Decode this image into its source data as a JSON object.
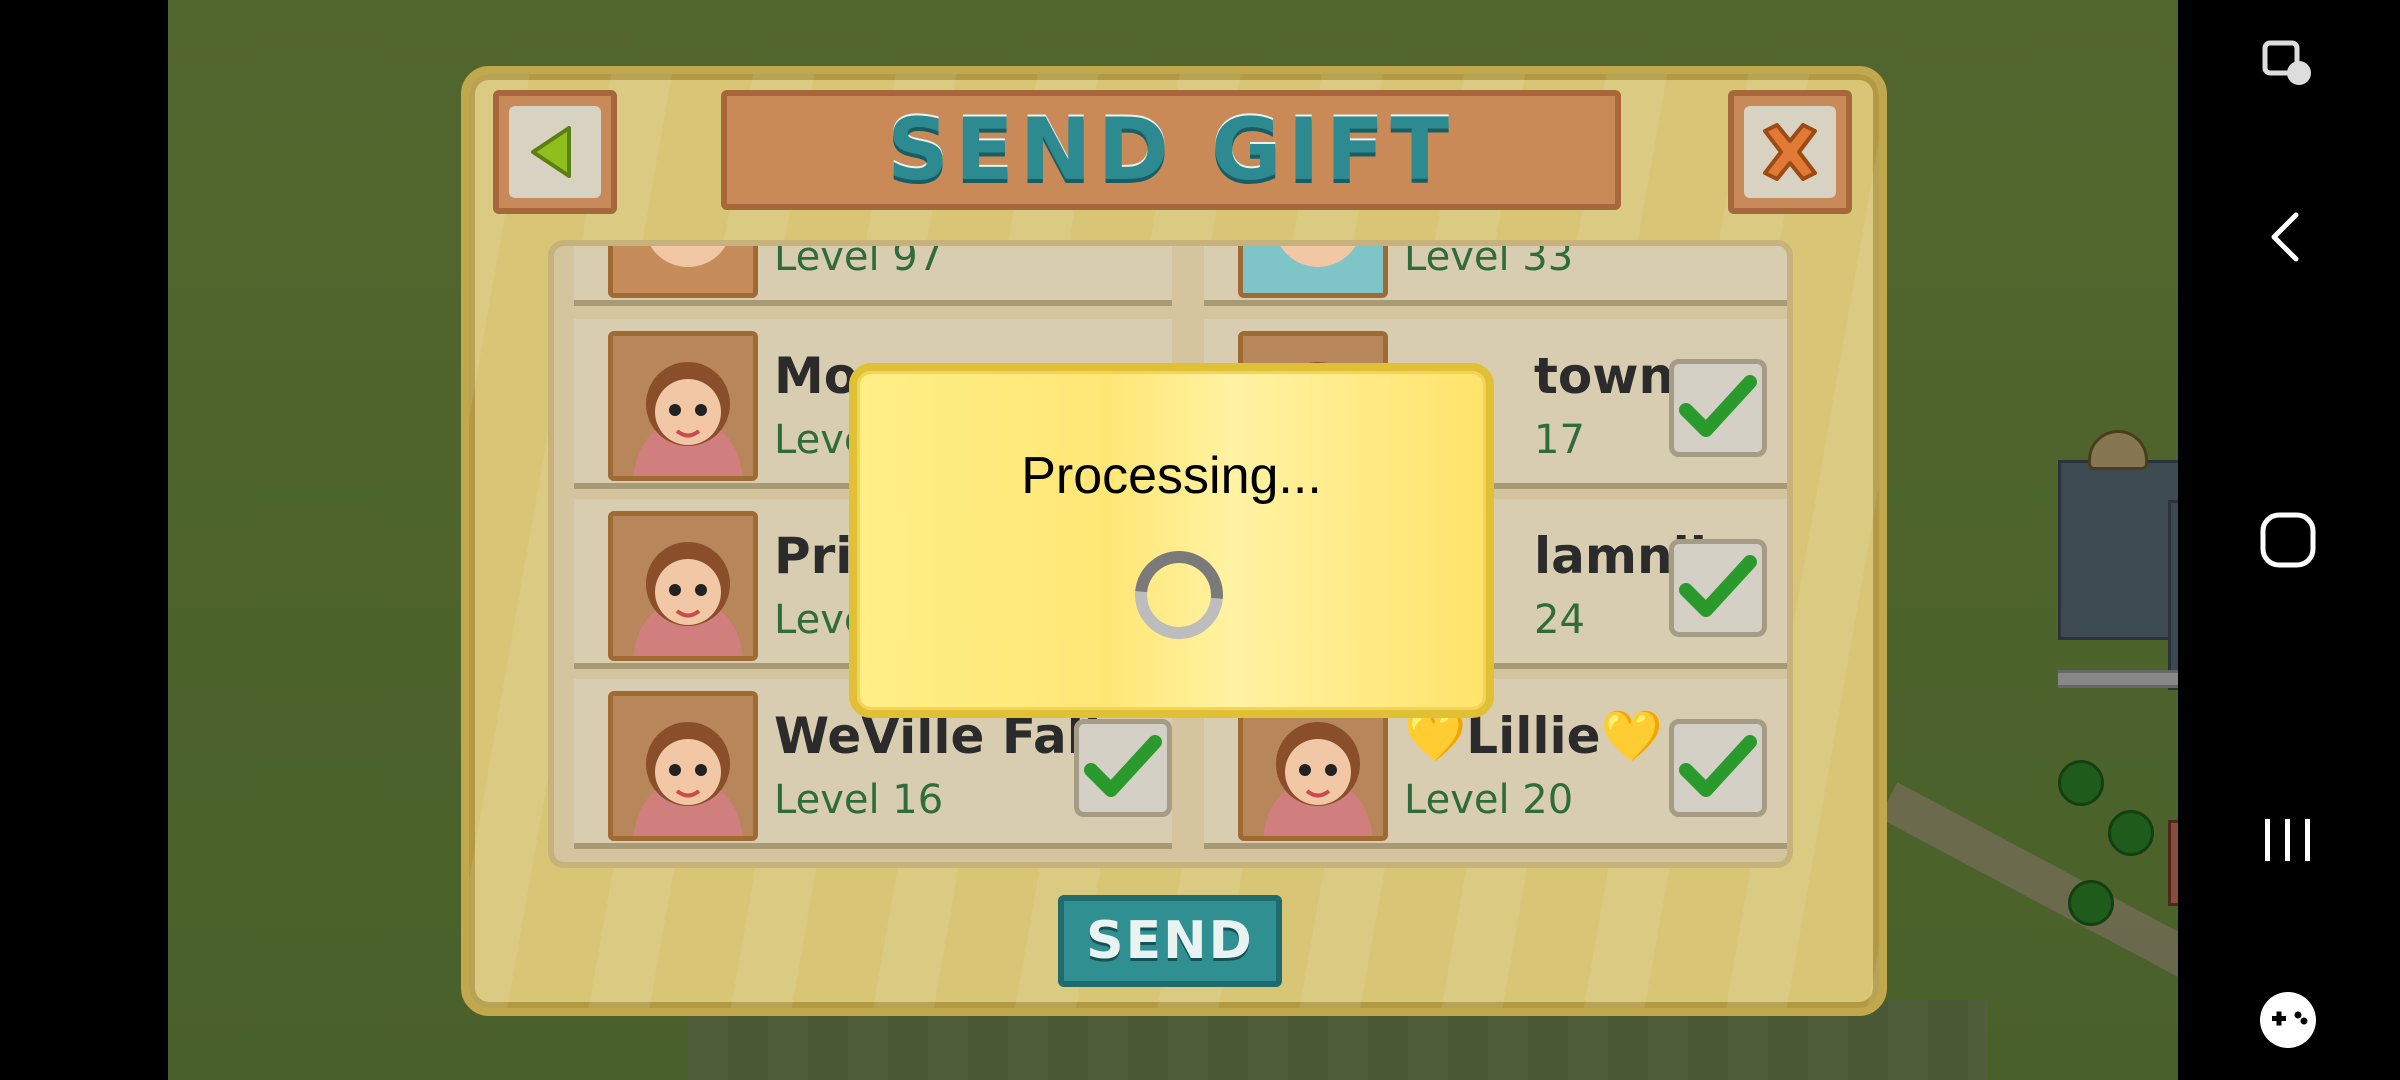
{
  "dialog": {
    "title": "SEND GIFT",
    "send_label": "SEND"
  },
  "friends": [
    {
      "name": "",
      "level": "Level 97"
    },
    {
      "name": "",
      "level": "Level 33"
    },
    {
      "name": "Mom",
      "level": "Level"
    },
    {
      "name": "town",
      "level": "17"
    },
    {
      "name": "Prin",
      "level": "Level"
    },
    {
      "name": "lamnlie",
      "level": "24"
    },
    {
      "name": "WeVille Falls",
      "level": "Level 16"
    },
    {
      "name": "💛Lillie💛",
      "level": "Level 20"
    }
  ],
  "processing": {
    "text": "Processing..."
  },
  "colors": {
    "accent_teal": "#2d8a90",
    "dialog_bg": "#d8c576",
    "processing_bg": "#ffe776",
    "check_green": "#2b9a2c"
  },
  "icons": {
    "back": "left-arrow-icon",
    "close": "close-x-icon",
    "check": "checkmark-icon",
    "nav_back": "chevron-left-icon",
    "nav_home": "square-icon",
    "nav_recents": "three-bars-icon",
    "nav_game": "gamepad-icon",
    "nav_top": "screen-touch-icon"
  }
}
